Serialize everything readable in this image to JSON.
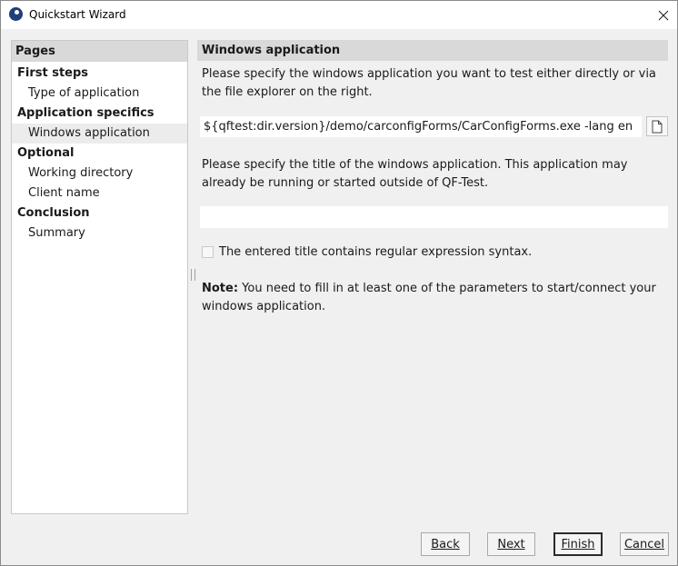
{
  "window": {
    "title": "Quickstart Wizard"
  },
  "pages": {
    "header": "Pages",
    "items": [
      {
        "label": "First steps",
        "type": "section"
      },
      {
        "label": "Type of application",
        "type": "sub"
      },
      {
        "label": "Application specifics",
        "type": "section"
      },
      {
        "label": "Windows application",
        "type": "sub",
        "active": true
      },
      {
        "label": "Optional",
        "type": "section"
      },
      {
        "label": "Working directory",
        "type": "sub"
      },
      {
        "label": "Client name",
        "type": "sub"
      },
      {
        "label": "Conclusion",
        "type": "section"
      },
      {
        "label": "Summary",
        "type": "sub"
      }
    ]
  },
  "main": {
    "header": "Windows application",
    "instruction1": "Please specify the windows application you want to test either directly or via the file explorer on the right.",
    "app_path_value": "${qftest:dir.version}/demo/carconfigForms/CarConfigForms.exe -lang en",
    "instruction2": "Please specify the title of the windows application. This application may already be running or started outside of QF-Test.",
    "title_value": "",
    "regex_label": "The entered title contains regular expression syntax.",
    "regex_checked": false,
    "note_bold": "Note:",
    "note_text": " You need to fill in at least one of the parameters to start/connect your windows application."
  },
  "buttons": {
    "back": "Back",
    "next": "Next",
    "finish": "Finish",
    "cancel": "Cancel"
  }
}
